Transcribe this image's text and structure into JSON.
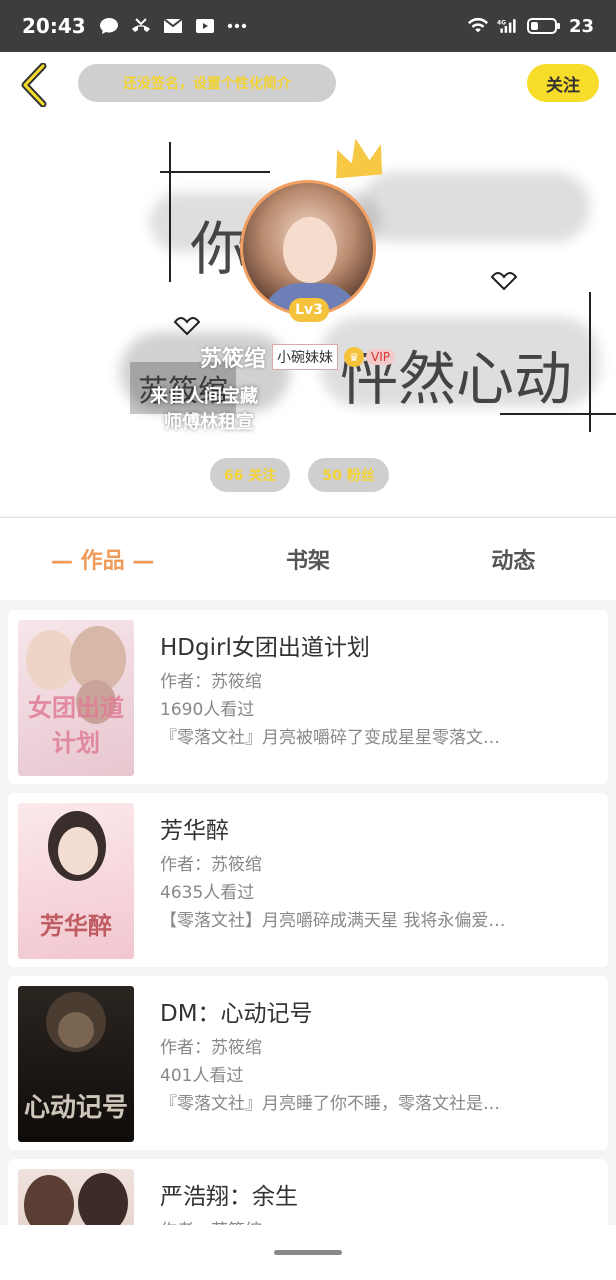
{
  "status_bar": {
    "time": "20:43",
    "battery": "23",
    "network": "4G"
  },
  "header": {
    "sign_placeholder": "还没签名，设置个性化简介",
    "follow_label": "关注"
  },
  "profile": {
    "nickname": "苏筱绾",
    "tag": "小碗妹妹",
    "vip_label": "VIP",
    "level": "Lv3",
    "bio_line1": "来自人间宝藏",
    "bio_line2": "师傅林租宣",
    "background_art": {
      "line1": "你的",
      "line2": "怦然心动",
      "stamp": "苏筱绾"
    }
  },
  "stats": {
    "following": "66 关注",
    "fans": "50 粉丝"
  },
  "tabs": [
    {
      "label": "— 作品 —",
      "active": true
    },
    {
      "label": "书架",
      "active": false
    },
    {
      "label": "动态",
      "active": false
    }
  ],
  "works": [
    {
      "title": "HDgirl女团出道计划",
      "author": "作者：苏筱绾",
      "views": "1690人看过",
      "desc": "『零落文社』月亮被嚼碎了变成星星零落文…",
      "cover_text": "女团出道计划",
      "cover_color": "#f2dfe4"
    },
    {
      "title": "芳华醉",
      "author": "作者：苏筱绾",
      "views": "4635人看过",
      "desc": "【零落文社】月亮嚼碎成满天星 我将永偏爱…",
      "cover_text": "芳华醉",
      "cover_color": "#f7d9dd"
    },
    {
      "title": "DM：心动记号",
      "author": "作者：苏筱绾",
      "views": "401人看过",
      "desc": "『零落文社』月亮睡了你不睡，零落文社是…",
      "cover_text": "心动记号",
      "cover_color": "#1e1a16"
    },
    {
      "title": "严浩翔：余生",
      "author": "作者：苏筱绾",
      "views": "",
      "desc": "",
      "cover_text": "",
      "cover_color": "#e9d8d0"
    }
  ],
  "colors": {
    "accent": "#f09a5a",
    "follow_yellow": "#f7dc2a",
    "pill_gray": "#cfcfcf"
  }
}
